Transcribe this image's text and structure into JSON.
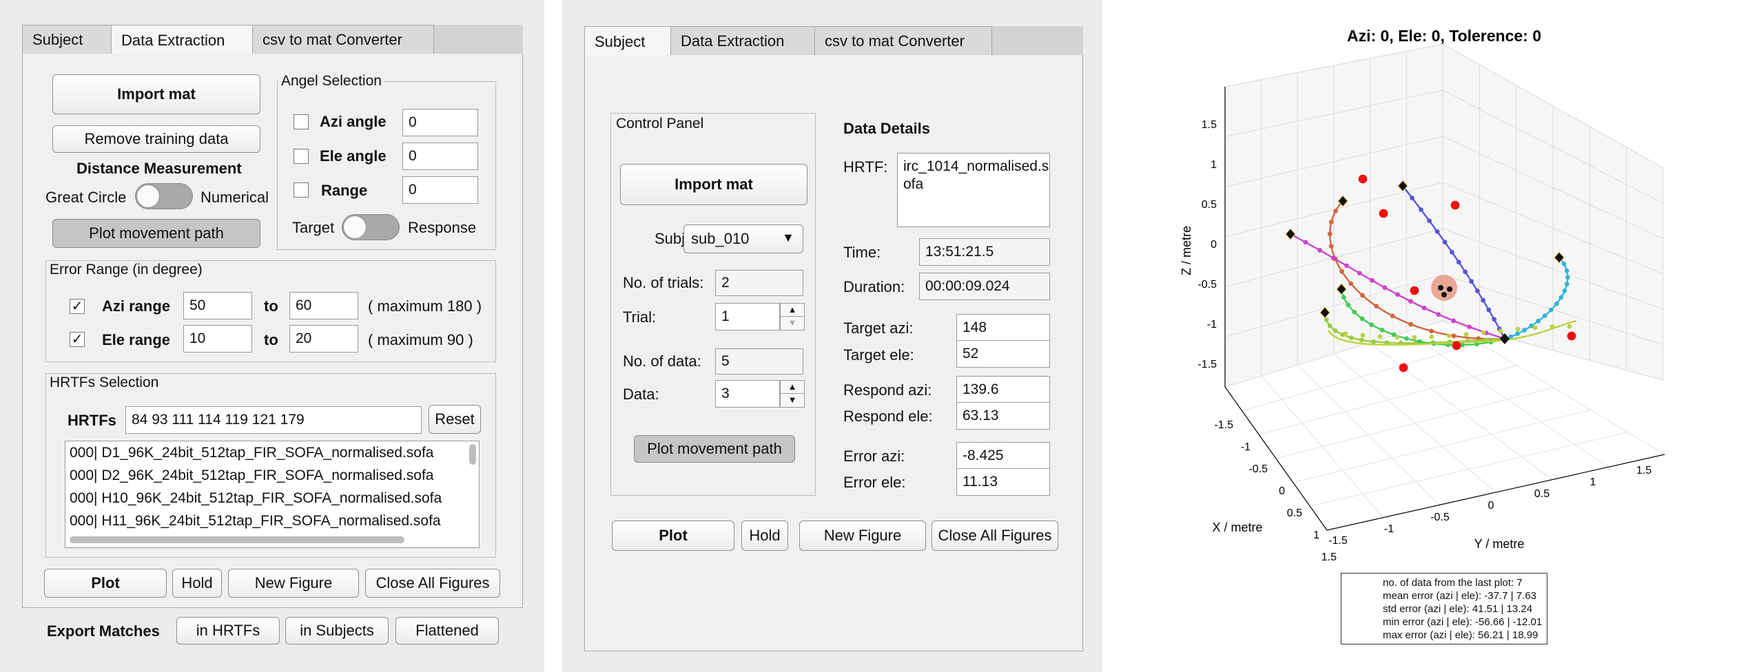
{
  "tabs": {
    "subject": "Subject",
    "extraction": "Data Extraction",
    "converter": "csv to mat Converter"
  },
  "left": {
    "import_mat": "Import mat",
    "remove_training": "Remove training data",
    "distance_title": "Distance Measurement",
    "great_circle": "Great Circle",
    "numerical": "Numerical",
    "plot_path": "Plot movement path",
    "angle_group": "Angel Selection",
    "azi_angle": "Azi angle",
    "azi_angle_val": "0",
    "ele_angle": "Ele angle",
    "ele_angle_val": "0",
    "range": "Range",
    "range_val": "0",
    "target": "Target",
    "response": "Response",
    "error_group": "Error Range (in degree)",
    "azi_range": "Azi range",
    "azi_from": "50",
    "azi_to": "60",
    "azi_max": "( maximum 180 )",
    "ele_range": "Ele range",
    "ele_from": "10",
    "ele_to": "20",
    "ele_max": "( maximum 90 )",
    "to": "to",
    "hrtf_group": "HRTFs Selection",
    "hrtfs_label": "HRTFs",
    "hrtfs_value": "84 93 111 114 119 121 179",
    "reset": "Reset",
    "hrtf_list": [
      "000| D1_96K_24bit_512tap_FIR_SOFA_normalised.sofa",
      "000| D2_96K_24bit_512tap_FIR_SOFA_normalised.sofa",
      "000| H10_96K_24bit_512tap_FIR_SOFA_normalised.sofa",
      "000| H11_96K_24bit_512tap_FIR_SOFA_normalised.sofa"
    ],
    "plot": "Plot",
    "hold": "Hold",
    "new_figure": "New Figure",
    "close_all": "Close All Figures",
    "export_label": "Export Matches",
    "in_hrtfs": "in HRTFs",
    "in_subjects": "in Subjects",
    "flattened": "Flattened"
  },
  "middle": {
    "control_panel": "Control Panel",
    "import_mat": "Import mat",
    "subject_label": "Subject",
    "subject_value": "sub_010",
    "trials_label": "No. of trials:",
    "trials_value": "2",
    "trial_label": "Trial:",
    "trial_value": "1",
    "ndata_label": "No. of data:",
    "ndata_value": "5",
    "data_label": "Data:",
    "data_value": "3",
    "plot_path": "Plot movement path",
    "details_title": "Data Details",
    "hrtf_label": "HRTF:",
    "hrtf_value": "irc_1014_normalised.sofa",
    "time_label": "Time:",
    "time_value": "13:51:21.5",
    "duration_label": "Duration:",
    "duration_value": "00:00:09.024",
    "target_azi_label": "Target azi:",
    "target_azi": "148",
    "target_ele_label": "Target ele:",
    "target_ele": "52",
    "respond_azi_label": "Respond azi:",
    "respond_azi": "139.6",
    "respond_ele_label": "Respond ele:",
    "respond_ele": "63.13",
    "error_azi_label": "Error azi:",
    "error_azi": "-8.425",
    "error_ele_label": "Error ele:",
    "error_ele": "11.13",
    "plot": "Plot",
    "hold": "Hold",
    "new_figure": "New Figure",
    "close_all": "Close All Figures"
  },
  "plot": {
    "title": "Azi: 0, Ele: 0, Tolerence: 0",
    "zlabel": "Z / metre",
    "xlabel": "X / metre",
    "ylabel": "Y / metre",
    "z_ticks": [
      "1.5",
      "1",
      "0.5",
      "0",
      "-0.5",
      "-1",
      "-1.5"
    ],
    "x_ticks": [
      "-1.5",
      "-1",
      "-0.5",
      "0",
      "0.5",
      "1",
      "1.5"
    ],
    "y_ticks": [
      "-1.5",
      "-1",
      "-0.5",
      "0",
      "0.5",
      "1",
      "1.5"
    ],
    "stats": [
      "no. of data from the last plot: 7",
      "mean error (azi | ele): -37.7 | 7.63",
      "std error (azi | ele): 41.51 | 13.24",
      "min error (azi | ele): -56.66 | -12.01",
      "max error (azi | ele): 56.21 | 18.99"
    ],
    "colors": {
      "target": "#ee1111",
      "head": "#e9a894",
      "path_colors": [
        "#d2663f",
        "#cc44cc",
        "#5a55d4",
        "#33b5d8",
        "#9acd40",
        "#44cc55",
        "#c0d040"
      ]
    }
  }
}
